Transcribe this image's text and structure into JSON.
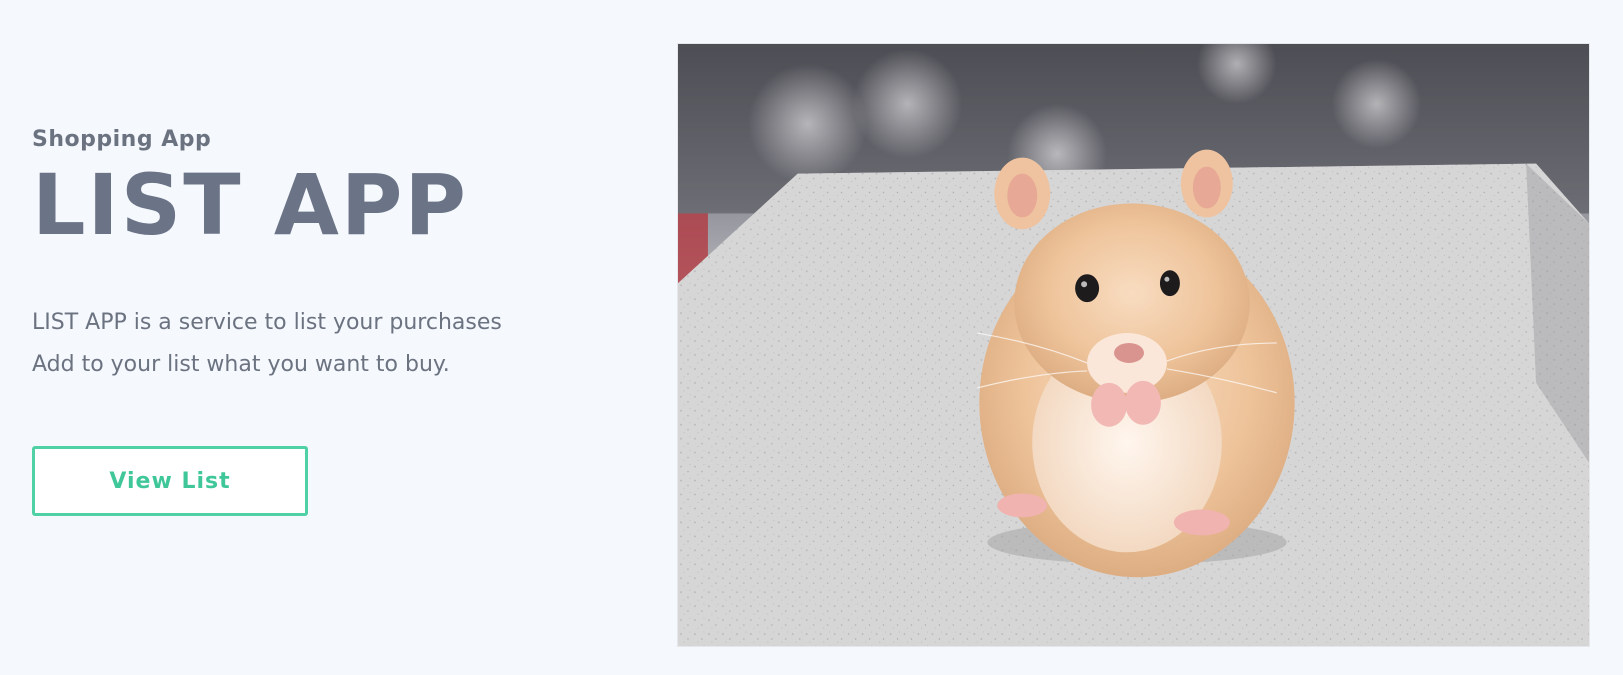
{
  "hero": {
    "subtitle": "Shopping App",
    "title": "LIST APP",
    "description_lines": [
      "LIST APP is a service to list your purchases",
      "Add to your list what you want to buy."
    ],
    "button_label": "View List"
  },
  "image": {
    "subject": "hamster-photo"
  },
  "colors": {
    "background": "#f5f8fd",
    "heading": "#6b7487",
    "text": "#6b7280",
    "accent": "#4fd1a5"
  }
}
